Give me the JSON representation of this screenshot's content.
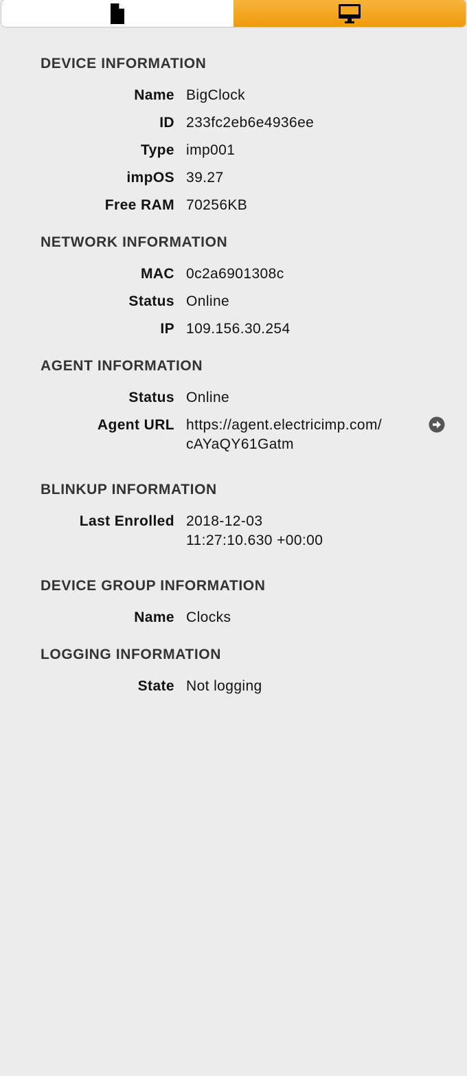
{
  "tabs": {
    "files_icon": "file-icon",
    "device_icon": "monitor-icon",
    "active_color": "#f0a010"
  },
  "device": {
    "title": "DEVICE INFORMATION",
    "name_label": "Name",
    "name_value": "BigClock",
    "id_label": "ID",
    "id_value": "233fc2eb6e4936ee",
    "type_label": "Type",
    "type_value": "imp001",
    "impos_label": "impOS",
    "impos_value": "39.27",
    "ram_label": "Free RAM",
    "ram_value": "70256KB"
  },
  "network": {
    "title": "NETWORK INFORMATION",
    "mac_label": "MAC",
    "mac_value": "0c2a6901308c",
    "status_label": "Status",
    "status_value": "Online",
    "ip_label": "IP",
    "ip_value": "109.156.30.254"
  },
  "agent": {
    "title": "AGENT INFORMATION",
    "status_label": "Status",
    "status_value": "Online",
    "url_label": "Agent URL",
    "url_value_line1": "https://agent.electricimp.com/",
    "url_value_line2": "cAYaQY61Gatm",
    "goto_icon": "arrow-circle-right-icon"
  },
  "blinkup": {
    "title": "BLINKUP INFORMATION",
    "enrolled_label": "Last Enrolled",
    "enrolled_value_line1": "2018-12-03",
    "enrolled_value_line2": "11:27:10.630 +00:00"
  },
  "group": {
    "title": "DEVICE GROUP INFORMATION",
    "name_label": "Name",
    "name_value": "Clocks"
  },
  "logging": {
    "title": "LOGGING INFORMATION",
    "state_label": "State",
    "state_value": "Not logging"
  }
}
